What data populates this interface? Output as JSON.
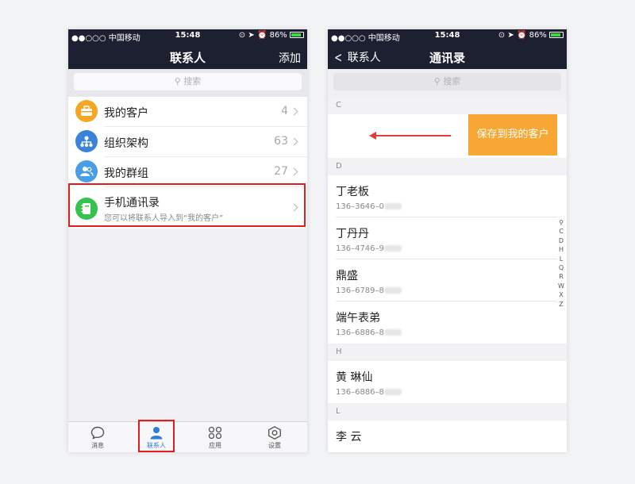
{
  "left": {
    "status": {
      "carrier": "●●○○○ 中国移动",
      "time": "15:48",
      "battery": "86%"
    },
    "nav": {
      "title": "联系人",
      "action": "添加"
    },
    "search": {
      "placeholder": "搜索"
    },
    "menu": [
      {
        "label": "我的客户",
        "count": "4",
        "color": "#f5a623",
        "icon": "briefcase-icon"
      },
      {
        "label": "组织架构",
        "count": "63",
        "color": "#3b82d9",
        "icon": "org-chart-icon"
      },
      {
        "label": "我的群组",
        "count": "27",
        "color": "#4a9ee8",
        "icon": "group-icon"
      }
    ],
    "phone_book": {
      "title": "手机通讯录",
      "subtitle": "您可以将联系人导入到“我的客户”",
      "color": "#35c24d",
      "icon": "phonebook-icon"
    },
    "tabs": [
      {
        "label": "消息",
        "icon": "chat-icon"
      },
      {
        "label": "联系人",
        "icon": "person-icon",
        "active": true
      },
      {
        "label": "应用",
        "icon": "apps-icon"
      },
      {
        "label": "设置",
        "icon": "settings-icon"
      }
    ]
  },
  "right": {
    "status": {
      "carrier": "●●○○○ 中国移动",
      "time": "15:48",
      "battery": "86%"
    },
    "nav": {
      "back": "联系人",
      "title": "通讯录"
    },
    "search": {
      "placeholder": "搜索"
    },
    "sections": {
      "c": "C",
      "d": "D",
      "h": "H",
      "l": "L"
    },
    "swipe_action": "保存到我的客户",
    "contacts": [
      {
        "name": "丁老板",
        "phone": "136–3646–0"
      },
      {
        "name": "丁丹丹",
        "phone": "136–4746–9"
      },
      {
        "name": "鼎盛",
        "phone": "136–6789–8"
      },
      {
        "name": "端午表弟",
        "phone": "136–6886–8"
      },
      {
        "name": "黄 琳仙",
        "phone": "136–6886–8"
      },
      {
        "name": "李 云",
        "phone": ""
      }
    ],
    "index_letters": [
      "C",
      "D",
      "H",
      "L",
      "Q",
      "R",
      "W",
      "X",
      "Z"
    ]
  },
  "colors": {
    "navbar": "#1c2031",
    "highlight_red": "#e01e1e",
    "swipe_orange": "#f7a734",
    "active_tab": "#2b7de0"
  }
}
